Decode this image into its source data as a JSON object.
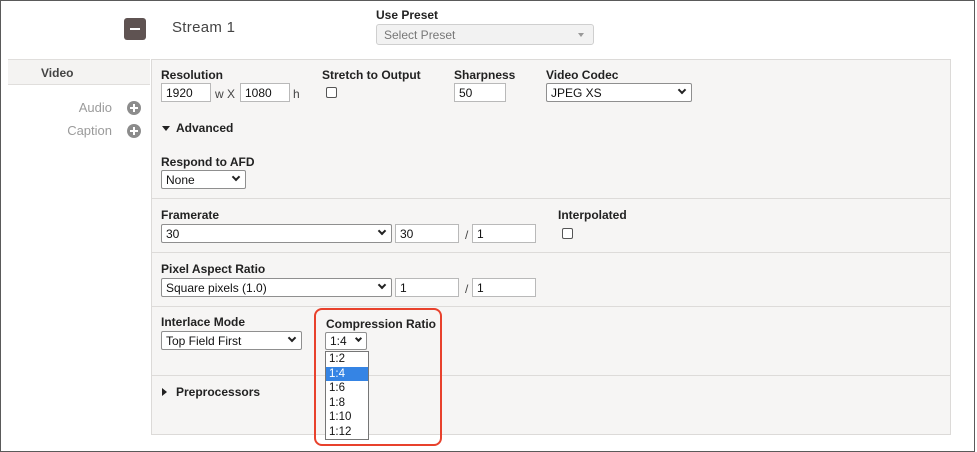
{
  "stream": {
    "title": "Stream 1"
  },
  "preset": {
    "label": "Use Preset",
    "placeholder": "Select Preset"
  },
  "tabs": {
    "video": "Video",
    "audio": "Audio",
    "caption": "Caption"
  },
  "resolution": {
    "label": "Resolution",
    "width": "1920",
    "sep": "w X",
    "height": "1080",
    "unit": "h"
  },
  "stretch": {
    "label": "Stretch to Output",
    "checked": false
  },
  "sharpness": {
    "label": "Sharpness",
    "value": "50"
  },
  "codec": {
    "label": "Video Codec",
    "value": "JPEG XS"
  },
  "advanced": {
    "label": "Advanced",
    "expanded": true
  },
  "afd": {
    "label": "Respond to AFD",
    "value": "None"
  },
  "framerate": {
    "label": "Framerate",
    "value": "30",
    "num": "30",
    "sep": "/",
    "den": "1"
  },
  "interpolated": {
    "label": "Interpolated",
    "checked": false
  },
  "par": {
    "label": "Pixel Aspect Ratio",
    "value": "Square pixels (1.0)",
    "num": "1",
    "sep": "/",
    "den": "1"
  },
  "interlace": {
    "label": "Interlace Mode",
    "value": "Top Field First"
  },
  "compression": {
    "label": "Compression Ratio",
    "value": "1:4",
    "options": [
      "1:2",
      "1:4",
      "1:6",
      "1:8",
      "1:10",
      "1:12"
    ],
    "highlighted_index": 1,
    "highlight_color": "#e8412c"
  },
  "preprocessors": {
    "label": "Preprocessors",
    "expanded": false
  }
}
